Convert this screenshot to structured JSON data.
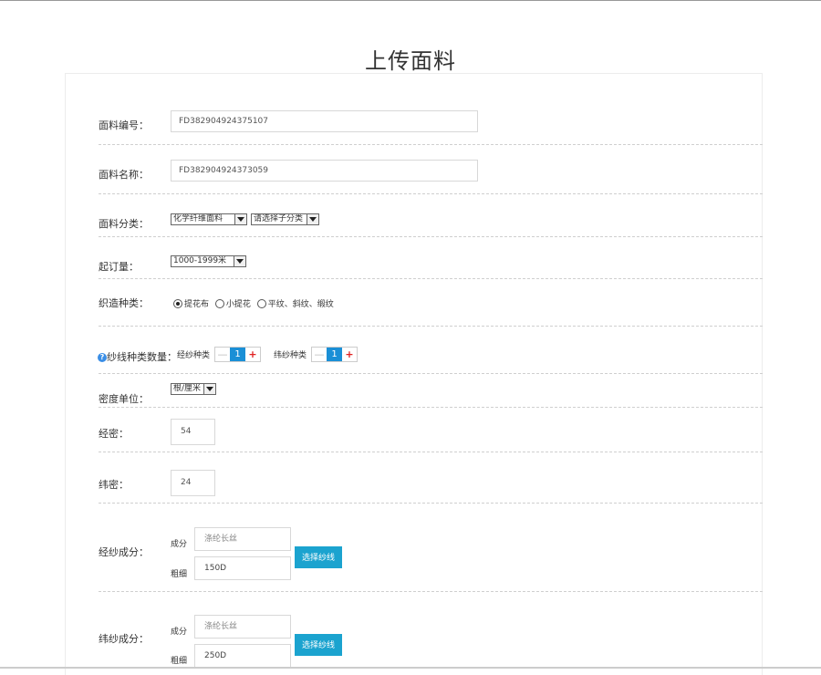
{
  "title": "上传面料",
  "fabric_code": {
    "label": "面料编号：",
    "value": "FD382904924375107"
  },
  "fabric_name": {
    "label": "面料名称：",
    "value": "FD382904924373059"
  },
  "fabric_category": {
    "label": "面料分类：",
    "category": "化学纤维面料",
    "subcategory": "请选择子分类"
  },
  "min_order": {
    "label": "起订量：",
    "value": "1000-1999米"
  },
  "weave_type": {
    "label": "织造种类：",
    "options": [
      "提花布",
      "小提花",
      "平纹、斜纹、缎纹"
    ],
    "selected_index": 0
  },
  "yarn_count": {
    "label": "纱线种类数量：",
    "warp_label": "经纱种类",
    "warp_value": "1",
    "weft_label": "纬纱种类",
    "weft_value": "1",
    "minus": "—",
    "plus": "+",
    "help": "?"
  },
  "density_unit": {
    "label": "密度单位：",
    "value": "根/厘米"
  },
  "warp_density": {
    "label": "经密：",
    "value": "54"
  },
  "weft_density": {
    "label": "纬密：",
    "value": "24"
  },
  "warp_composition": {
    "label": "经纱成分：",
    "component_label": "成分",
    "component_placeholder": "涤纶长丝",
    "thickness_label": "粗细",
    "thickness_value": "150D",
    "select_button": "选择纱线"
  },
  "weft_composition": {
    "label": "纬纱成分：",
    "component_label": "成分",
    "component_placeholder": "涤纶长丝",
    "thickness_label": "粗细",
    "thickness_value": "250D",
    "select_button": "选择纱线"
  },
  "colors": {
    "accent_blue": "#1ba3cf",
    "stepper_blue": "#1a8fd6",
    "plus_red": "#e02020"
  }
}
